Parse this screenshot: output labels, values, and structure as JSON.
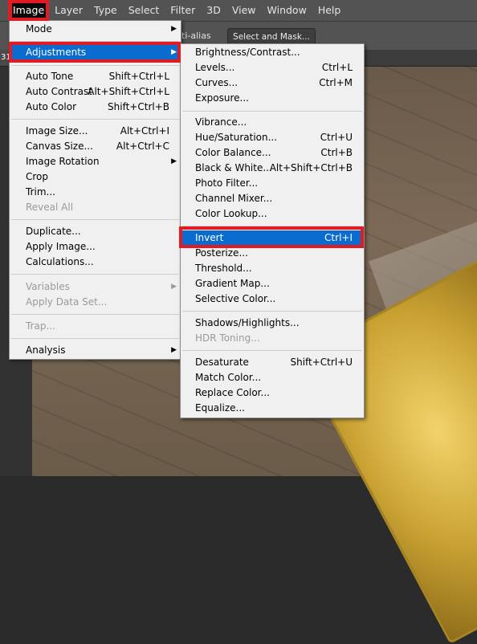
{
  "menubar": {
    "items": [
      "Image",
      "Layer",
      "Type",
      "Select",
      "Filter",
      "3D",
      "View",
      "Window",
      "Help"
    ]
  },
  "optionsbar": {
    "antialias_label": "ti-alias",
    "select_mask_label": "Select and Mask..."
  },
  "tabstrip": {
    "tab_label": "31"
  },
  "image_menu": {
    "mode": "Mode",
    "adjustments": "Adjustments",
    "auto_tone": "Auto Tone",
    "auto_tone_sc": "Shift+Ctrl+L",
    "auto_contrast": "Auto Contrast",
    "auto_contrast_sc": "Alt+Shift+Ctrl+L",
    "auto_color": "Auto Color",
    "auto_color_sc": "Shift+Ctrl+B",
    "image_size": "Image Size...",
    "image_size_sc": "Alt+Ctrl+I",
    "canvas_size": "Canvas Size...",
    "canvas_size_sc": "Alt+Ctrl+C",
    "image_rotation": "Image Rotation",
    "crop": "Crop",
    "trim": "Trim...",
    "reveal_all": "Reveal All",
    "duplicate": "Duplicate...",
    "apply_image": "Apply Image...",
    "calculations": "Calculations...",
    "variables": "Variables",
    "apply_data_set": "Apply Data Set...",
    "trap": "Trap...",
    "analysis": "Analysis"
  },
  "adjustments_menu": {
    "brightness_contrast": "Brightness/Contrast...",
    "levels": "Levels...",
    "levels_sc": "Ctrl+L",
    "curves": "Curves...",
    "curves_sc": "Ctrl+M",
    "exposure": "Exposure...",
    "vibrance": "Vibrance...",
    "hue_saturation": "Hue/Saturation...",
    "hue_saturation_sc": "Ctrl+U",
    "color_balance": "Color Balance...",
    "color_balance_sc": "Ctrl+B",
    "black_white": "Black & White...",
    "black_white_sc": "Alt+Shift+Ctrl+B",
    "photo_filter": "Photo Filter...",
    "channel_mixer": "Channel Mixer...",
    "color_lookup": "Color Lookup...",
    "invert": "Invert",
    "invert_sc": "Ctrl+I",
    "posterize": "Posterize...",
    "threshold": "Threshold...",
    "gradient_map": "Gradient Map...",
    "selective_color": "Selective Color...",
    "shadows_highlights": "Shadows/Highlights...",
    "hdr_toning": "HDR Toning...",
    "desaturate": "Desaturate",
    "desaturate_sc": "Shift+Ctrl+U",
    "match_color": "Match Color...",
    "replace_color": "Replace Color...",
    "equalize": "Equalize..."
  },
  "colors": {
    "highlight": "#0b6ccf",
    "annotation_red": "#e01b24",
    "menu_bg": "#f0f0f0",
    "menubar_bg": "#535353"
  }
}
